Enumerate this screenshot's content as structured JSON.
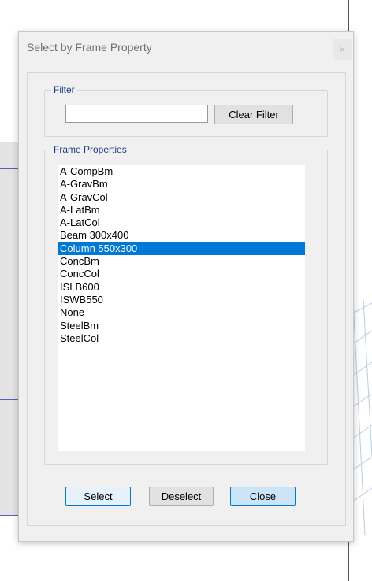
{
  "dialog": {
    "title": "Select by Frame Property",
    "close_glyph": "×"
  },
  "filter": {
    "group_label": "Filter",
    "input_value": "",
    "clear_button": "Clear Filter"
  },
  "frame_properties": {
    "group_label": "Frame Properties",
    "selected_item": "Column 550x300",
    "items": [
      "A-CompBm",
      "A-GravBm",
      "A-GravCol",
      "A-LatBm",
      "A-LatCol",
      "Beam 300x400",
      "Column 550x300",
      "ConcBm",
      "ConcCol",
      "ISLB600",
      "ISWB550",
      "None",
      "SteelBm",
      "SteelCol"
    ]
  },
  "buttons": {
    "select": "Select",
    "deselect": "Deselect",
    "close": "Close"
  },
  "colors": {
    "selection": "#0078d7",
    "group_label": "#1a3d8a",
    "dialog_bg": "#f0f0f0"
  }
}
